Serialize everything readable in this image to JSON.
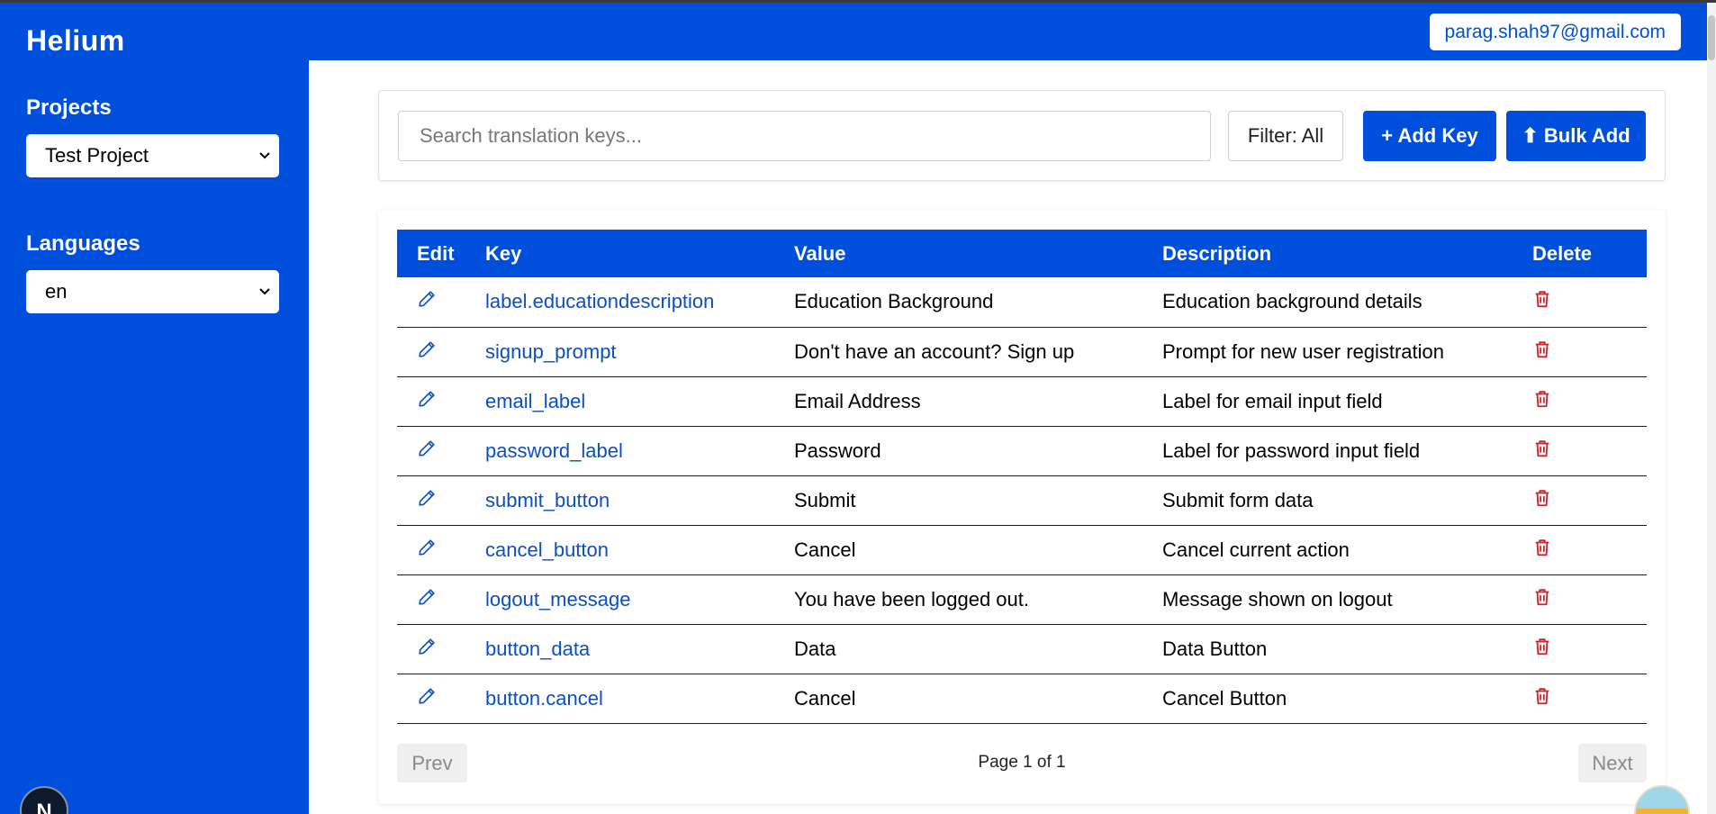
{
  "app": {
    "title": "Helium"
  },
  "header": {
    "user_email": "parag.shah97@gmail.com"
  },
  "sidebar": {
    "projects_label": "Projects",
    "project_selected": "Test Project",
    "languages_label": "Languages",
    "language_selected": "en"
  },
  "toolbar": {
    "search_placeholder": "Search translation keys...",
    "filter_label": "Filter: All",
    "add_key_label": "+ Add Key",
    "bulk_add_label": "⬆ Bulk Add"
  },
  "table": {
    "columns": {
      "edit": "Edit",
      "key": "Key",
      "value": "Value",
      "description": "Description",
      "delete": "Delete"
    },
    "rows": [
      {
        "key": "label.educationdescription",
        "value": "Education Background",
        "description": "Education background details"
      },
      {
        "key": "signup_prompt",
        "value": "Don't have an account? Sign up",
        "description": "Prompt for new user registration"
      },
      {
        "key": "email_label",
        "value": "Email Address",
        "description": "Label for email input field"
      },
      {
        "key": "password_label",
        "value": "Password",
        "description": "Label for password input field"
      },
      {
        "key": "submit_button",
        "value": "Submit",
        "description": "Submit form data"
      },
      {
        "key": "cancel_button",
        "value": "Cancel",
        "description": "Cancel current action"
      },
      {
        "key": "logout_message",
        "value": "You have been logged out.",
        "description": "Message shown on logout"
      },
      {
        "key": "button_data",
        "value": "Data",
        "description": "Data Button"
      },
      {
        "key": "button.cancel",
        "value": "Cancel",
        "description": "Cancel Button"
      }
    ]
  },
  "pagination": {
    "prev_label": "Prev",
    "next_label": "Next",
    "page_info": "Page 1 of 1"
  },
  "misc": {
    "next_badge": "N"
  },
  "icons": {
    "edit": "pencil-icon",
    "delete": "trash-icon",
    "select": "chevron-down-icon"
  },
  "colors": {
    "brand": "#004fdc",
    "key_link": "#0d4fc2",
    "delete": "#d0202a"
  }
}
